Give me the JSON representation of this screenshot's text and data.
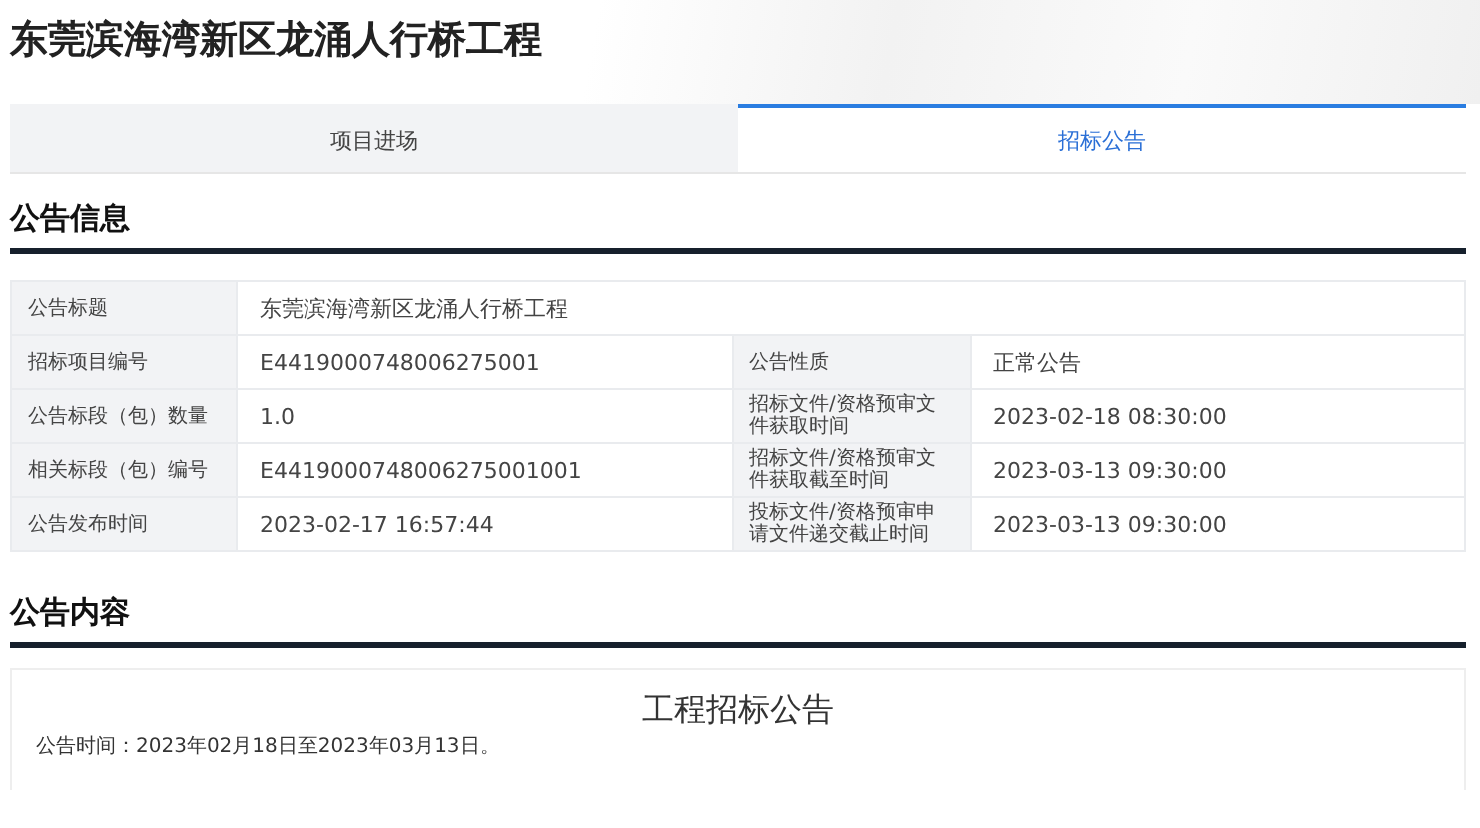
{
  "page_title": "东莞滨海湾新区龙涌人行桥工程",
  "tabs": [
    {
      "label": "项目进场",
      "selected": false
    },
    {
      "label": "招标公告",
      "selected": true
    }
  ],
  "info_section": {
    "heading": "公告信息",
    "rows": [
      {
        "cells": [
          {
            "label": "公告标题",
            "value": "东莞滨海湾新区龙涌人行桥工程"
          }
        ]
      },
      {
        "cells": [
          {
            "label": "招标项目编号",
            "value": "E4419000748006275001"
          },
          {
            "label": "公告性质",
            "value": "正常公告"
          }
        ]
      },
      {
        "cells": [
          {
            "label": "公告标段（包）数量",
            "value": "1.0"
          },
          {
            "label": "招标文件/资格预审文件获取时间",
            "value": "2023-02-18 08:30:00"
          }
        ]
      },
      {
        "cells": [
          {
            "label": "相关标段（包）编号",
            "value": "E4419000748006275001001"
          },
          {
            "label": "招标文件/资格预审文件获取截至时间",
            "value": "2023-03-13 09:30:00"
          }
        ]
      },
      {
        "cells": [
          {
            "label": "公告发布时间",
            "value": "2023-02-17 16:57:44"
          },
          {
            "label": "投标文件/资格预审申请文件递交截止时间",
            "value": "2023-03-13 09:30:00"
          }
        ]
      }
    ]
  },
  "content_section": {
    "heading": "公告内容",
    "document_title": "工程招标公告",
    "notice_time": "公告时间：2023年02月18日至2023年03月13日。"
  }
}
